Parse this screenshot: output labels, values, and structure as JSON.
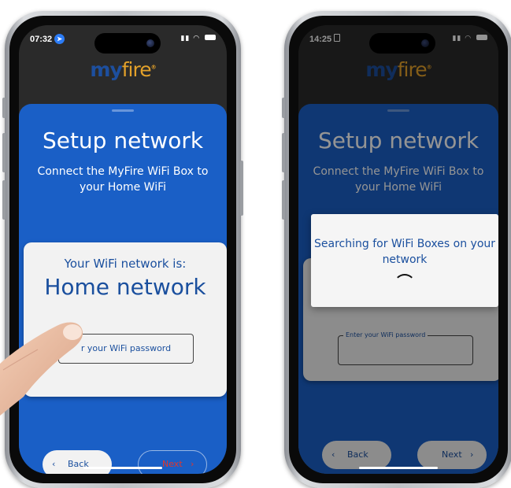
{
  "left_phone": {
    "status_time": "07:32",
    "logo": {
      "my": "my",
      "fire": "fire",
      "reg": "®"
    },
    "title": "Setup network",
    "subtitle": "Connect the MyFire WiFi Box to your Home WiFi",
    "card_label": "Your WiFi network is:",
    "network_name": "Home network",
    "password_placeholder": "r your WiFi password",
    "back_label": "Back",
    "next_label": "Next",
    "next_color": "#e2362c"
  },
  "right_phone": {
    "status_time": "14:25",
    "logo": {
      "my": "my",
      "fire": "fire",
      "reg": "®"
    },
    "title": "Setup network",
    "subtitle": "Connect the MyFire WiFi Box to your Home WiFi",
    "password_legend": "Enter your WiFi password",
    "dialog_text": "Searching for WiFi Boxes on your network",
    "back_label": "Back",
    "next_label": "Next"
  },
  "colors": {
    "primary_blue": "#1a5fc6",
    "text_blue": "#1a4f9e",
    "logo_orange": "#e3a12a"
  },
  "icons": {
    "location": "location-arrow-icon",
    "lock": "lock-icon",
    "back": "chevron-left-icon",
    "next": "chevron-right-icon",
    "spinner": "loading-spinner-icon"
  }
}
